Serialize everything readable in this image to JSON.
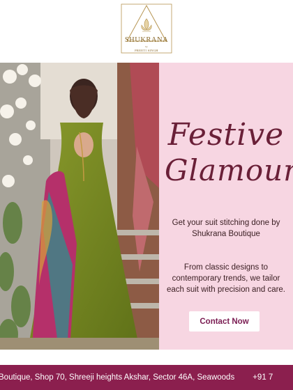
{
  "brand": {
    "name": "SHUKRANA",
    "by": "by",
    "owner": "PREETI SINGH"
  },
  "hero": {
    "title_line1": "Festive",
    "title_line2": "Glamour",
    "tagline": "Get your suit stitching done by Shukrana Boutique",
    "description": "From classic designs to contemporary trends, we tailor each suit with precision and care.",
    "cta_label": "Contact Now"
  },
  "footer": {
    "address": "Boutique, Shop 70, Shreeji heights Akshar, Sector 46A, Seawoods",
    "phone": "+91 7"
  },
  "colors": {
    "panel_bg": "#f7d6e2",
    "accent": "#8b1f4e",
    "title_color": "#6a2038",
    "logo_gold": "#8a6a2c"
  },
  "icons": {
    "logo": "shukrana-lotus-emblem"
  }
}
